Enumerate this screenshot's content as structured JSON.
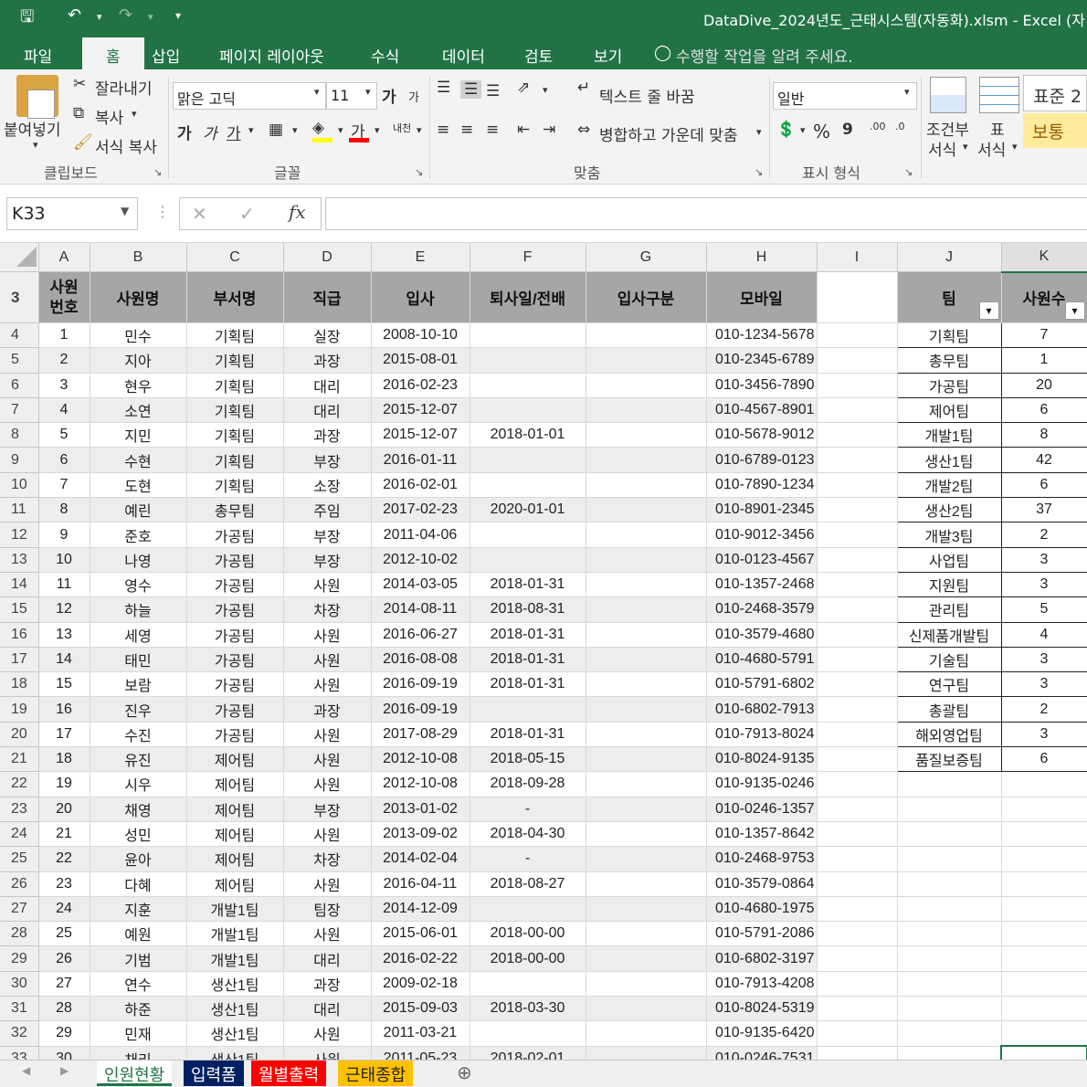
{
  "window": {
    "title": "DataDive_2024년도_근태시스템(자동화).xlsm - Excel (자"
  },
  "tabs": [
    "파일",
    "홈",
    "삽입",
    "페이지 레이아웃",
    "수식",
    "데이터",
    "검토",
    "보기"
  ],
  "tellme": "수행할 작업을 알려 주세요.",
  "ribbon": {
    "clipboard": {
      "paste": "붙여넣기",
      "cut": "잘라내기",
      "copy": "복사",
      "format_painter": "서식 복사",
      "group": "클립보드"
    },
    "font": {
      "name": "맑은 고딕",
      "size": "11",
      "bold": "가",
      "italic": "가",
      "underline": "가",
      "color_a": "가",
      "phonetic": "내천",
      "group": "글꼴",
      "grow": "가",
      "shrink": "가"
    },
    "alignment": {
      "wrap": "텍스트 줄 바꿈",
      "merge": "병합하고 가운데 맞춤",
      "group": "맞춤"
    },
    "number": {
      "format": "일반",
      "percent": "%",
      "comma": "9",
      "group": "표시 형식",
      "inc": ".00",
      "dec": ".0"
    },
    "styles": {
      "cond": "조건부",
      "cond2": "서식",
      "table": "표",
      "table2": "서식",
      "normal": "표준 2",
      "good": "보통"
    }
  },
  "formula_bar": {
    "name_box": "K33",
    "fx": "fx",
    "content": ""
  },
  "columns": [
    "A",
    "B",
    "C",
    "D",
    "E",
    "F",
    "G",
    "H",
    "I",
    "J",
    "K"
  ],
  "header_row": {
    "num": "3",
    "emp_id": "사원\n번호",
    "name": "사원명",
    "dept": "부서명",
    "rank": "직급",
    "join": "입사",
    "leave": "퇴사일/전배",
    "type": "입사구분",
    "mobile": "모바일",
    "team": "팀",
    "count": "사원수"
  },
  "rows": [
    {
      "r": "4",
      "id": "1",
      "name": "민수",
      "dept": "기획팀",
      "rank": "실장",
      "join": "2008-10-10",
      "leave": "",
      "mobile": "010-1234-5678"
    },
    {
      "r": "5",
      "id": "2",
      "name": "지아",
      "dept": "기획팀",
      "rank": "과장",
      "join": "2015-08-01",
      "leave": "",
      "mobile": "010-2345-6789"
    },
    {
      "r": "6",
      "id": "3",
      "name": "현우",
      "dept": "기획팀",
      "rank": "대리",
      "join": "2016-02-23",
      "leave": "",
      "mobile": "010-3456-7890"
    },
    {
      "r": "7",
      "id": "4",
      "name": "소연",
      "dept": "기획팀",
      "rank": "대리",
      "join": "2015-12-07",
      "leave": "",
      "mobile": "010-4567-8901"
    },
    {
      "r": "8",
      "id": "5",
      "name": "지민",
      "dept": "기획팀",
      "rank": "과장",
      "join": "2015-12-07",
      "leave": "2018-01-01",
      "mobile": "010-5678-9012"
    },
    {
      "r": "9",
      "id": "6",
      "name": "수현",
      "dept": "기획팀",
      "rank": "부장",
      "join": "2016-01-11",
      "leave": "",
      "mobile": "010-6789-0123"
    },
    {
      "r": "10",
      "id": "7",
      "name": "도현",
      "dept": "기획팀",
      "rank": "소장",
      "join": "2016-02-01",
      "leave": "",
      "mobile": "010-7890-1234"
    },
    {
      "r": "11",
      "id": "8",
      "name": "예린",
      "dept": "총무팀",
      "rank": "주임",
      "join": "2017-02-23",
      "leave": "2020-01-01",
      "mobile": "010-8901-2345"
    },
    {
      "r": "12",
      "id": "9",
      "name": "준호",
      "dept": "가공팀",
      "rank": "부장",
      "join": "2011-04-06",
      "leave": "",
      "mobile": "010-9012-3456"
    },
    {
      "r": "13",
      "id": "10",
      "name": "나영",
      "dept": "가공팀",
      "rank": "부장",
      "join": "2012-10-02",
      "leave": "",
      "mobile": "010-0123-4567"
    },
    {
      "r": "14",
      "id": "11",
      "name": "영수",
      "dept": "가공팀",
      "rank": "사원",
      "join": "2014-03-05",
      "leave": "2018-01-31",
      "mobile": "010-1357-2468"
    },
    {
      "r": "15",
      "id": "12",
      "name": "하늘",
      "dept": "가공팀",
      "rank": "차장",
      "join": "2014-08-11",
      "leave": "2018-08-31",
      "mobile": "010-2468-3579"
    },
    {
      "r": "16",
      "id": "13",
      "name": "세영",
      "dept": "가공팀",
      "rank": "사원",
      "join": "2016-06-27",
      "leave": "2018-01-31",
      "mobile": "010-3579-4680"
    },
    {
      "r": "17",
      "id": "14",
      "name": "태민",
      "dept": "가공팀",
      "rank": "사원",
      "join": "2016-08-08",
      "leave": "2018-01-31",
      "mobile": "010-4680-5791"
    },
    {
      "r": "18",
      "id": "15",
      "name": "보람",
      "dept": "가공팀",
      "rank": "사원",
      "join": "2016-09-19",
      "leave": "2018-01-31",
      "mobile": "010-5791-6802"
    },
    {
      "r": "19",
      "id": "16",
      "name": "진우",
      "dept": "가공팀",
      "rank": "과장",
      "join": "2016-09-19",
      "leave": "",
      "mobile": "010-6802-7913"
    },
    {
      "r": "20",
      "id": "17",
      "name": "수진",
      "dept": "가공팀",
      "rank": "사원",
      "join": "2017-08-29",
      "leave": "2018-01-31",
      "mobile": "010-7913-8024"
    },
    {
      "r": "21",
      "id": "18",
      "name": "유진",
      "dept": "제어팀",
      "rank": "사원",
      "join": "2012-10-08",
      "leave": "2018-05-15",
      "mobile": "010-8024-9135"
    },
    {
      "r": "22",
      "id": "19",
      "name": "시우",
      "dept": "제어팀",
      "rank": "사원",
      "join": "2012-10-08",
      "leave": "2018-09-28",
      "mobile": "010-9135-0246"
    },
    {
      "r": "23",
      "id": "20",
      "name": "채영",
      "dept": "제어팀",
      "rank": "부장",
      "join": "2013-01-02",
      "leave": "-",
      "mobile": "010-0246-1357"
    },
    {
      "r": "24",
      "id": "21",
      "name": "성민",
      "dept": "제어팀",
      "rank": "사원",
      "join": "2013-09-02",
      "leave": "2018-04-30",
      "mobile": "010-1357-8642"
    },
    {
      "r": "25",
      "id": "22",
      "name": "윤아",
      "dept": "제어팀",
      "rank": "차장",
      "join": "2014-02-04",
      "leave": "-",
      "mobile": "010-2468-9753"
    },
    {
      "r": "26",
      "id": "23",
      "name": "다혜",
      "dept": "제어팀",
      "rank": "사원",
      "join": "2016-04-11",
      "leave": "2018-08-27",
      "mobile": "010-3579-0864"
    },
    {
      "r": "27",
      "id": "24",
      "name": "지훈",
      "dept": "개발1팀",
      "rank": "팀장",
      "join": "2014-12-09",
      "leave": "",
      "mobile": "010-4680-1975"
    },
    {
      "r": "28",
      "id": "25",
      "name": "예원",
      "dept": "개발1팀",
      "rank": "사원",
      "join": "2015-06-01",
      "leave": "2018-00-00",
      "mobile": "010-5791-2086"
    },
    {
      "r": "29",
      "id": "26",
      "name": "기범",
      "dept": "개발1팀",
      "rank": "대리",
      "join": "2016-02-22",
      "leave": "2018-00-00",
      "mobile": "010-6802-3197"
    },
    {
      "r": "30",
      "id": "27",
      "name": "연수",
      "dept": "생산1팀",
      "rank": "과장",
      "join": "2009-02-18",
      "leave": "",
      "mobile": "010-7913-4208"
    },
    {
      "r": "31",
      "id": "28",
      "name": "하준",
      "dept": "생산1팀",
      "rank": "대리",
      "join": "2015-09-03",
      "leave": "2018-03-30",
      "mobile": "010-8024-5319"
    },
    {
      "r": "32",
      "id": "29",
      "name": "민재",
      "dept": "생산1팀",
      "rank": "사원",
      "join": "2011-03-21",
      "leave": "",
      "mobile": "010-9135-6420"
    },
    {
      "r": "33",
      "id": "30",
      "name": "채리",
      "dept": "생산1팀",
      "rank": "사원",
      "join": "2011-05-23",
      "leave": "2018-02-01",
      "mobile": "010-0246-7531"
    }
  ],
  "teams": [
    {
      "team": "기획팀",
      "count": "7"
    },
    {
      "team": "총무팀",
      "count": "1"
    },
    {
      "team": "가공팀",
      "count": "20"
    },
    {
      "team": "제어팀",
      "count": "6"
    },
    {
      "team": "개발1팀",
      "count": "8"
    },
    {
      "team": "생산1팀",
      "count": "42"
    },
    {
      "team": "개발2팀",
      "count": "6"
    },
    {
      "team": "생산2팀",
      "count": "37"
    },
    {
      "team": "개발3팀",
      "count": "2"
    },
    {
      "team": "사업팀",
      "count": "3"
    },
    {
      "team": "지원팀",
      "count": "3"
    },
    {
      "team": "관리팀",
      "count": "5"
    },
    {
      "team": "신제품개발팀",
      "count": "4"
    },
    {
      "team": "기술팀",
      "count": "3"
    },
    {
      "team": "연구팀",
      "count": "3"
    },
    {
      "team": "총괄팀",
      "count": "2"
    },
    {
      "team": "해외영업팀",
      "count": "3"
    },
    {
      "team": "품질보증팀",
      "count": "6"
    }
  ],
  "sheets": [
    {
      "name": "인원현황",
      "bg": "#ffffff",
      "fg": "#217346"
    },
    {
      "name": "입력폼",
      "bg": "#002060",
      "fg": "#ffffff"
    },
    {
      "name": "월별출력",
      "bg": "#ff0000",
      "fg": "#ffffff"
    },
    {
      "name": "근태종합",
      "bg": "#ffc000",
      "fg": "#222222"
    }
  ]
}
